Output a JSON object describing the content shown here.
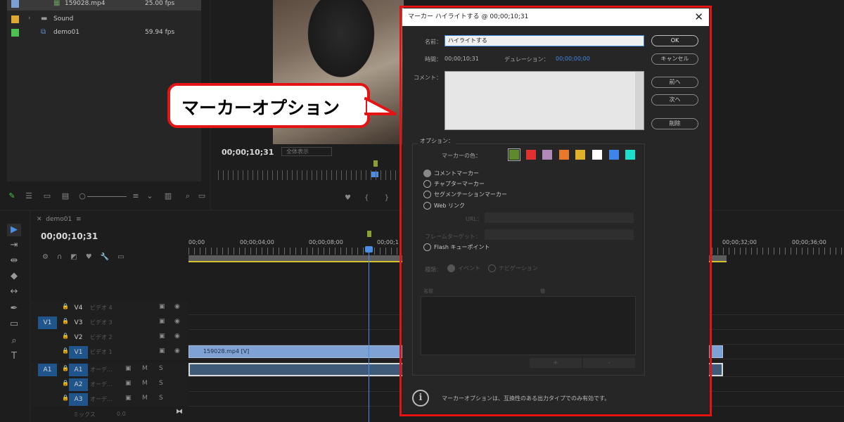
{
  "project": {
    "rows": [
      {
        "name": "159028.mp4",
        "fps": "25.00 fps",
        "color": "#7aa0d4"
      },
      {
        "name": "Sound",
        "fps": "",
        "color": "#e0a830"
      },
      {
        "name": "demo01",
        "fps": "59.94 fps",
        "color": "#4ec050"
      }
    ]
  },
  "program": {
    "timecode": "00;00;10;31",
    "zoom": "全体表示"
  },
  "timeline": {
    "tab": "demo01",
    "timecode": "00;00;10;31",
    "ruler": [
      "00;00",
      "00;00;04;00",
      "00;00;08;00",
      "00;00;1",
      "00;00;32;00",
      "00;00;36;00"
    ],
    "tracks": [
      {
        "src": "",
        "id": "V4",
        "name": "ビデオ 4"
      },
      {
        "src": "V1",
        "id": "V3",
        "name": "ビデオ 3"
      },
      {
        "src": "",
        "id": "V2",
        "name": "ビデオ 2"
      },
      {
        "src": "",
        "id": "V1",
        "name": "ビデオ 1"
      },
      {
        "src": "A1",
        "id": "A1",
        "name": "オーデ..."
      },
      {
        "src": "",
        "id": "A2",
        "name": "オーデ..."
      },
      {
        "src": "",
        "id": "A3",
        "name": "オーデ..."
      }
    ],
    "clip_label": "159028.mp4 [V]",
    "mix_label": "ミックス",
    "mix_value": "0.0",
    "m_label": "M",
    "s_label": "S"
  },
  "callout": {
    "text": "マーカーオプション"
  },
  "dialog": {
    "title": "マーカー ハイライトする @ 00;00;10;31",
    "name_label": "名前：",
    "name_value": "ハイライトする",
    "time_label": "時間：",
    "time_value": "00;00;10;31",
    "duration_label": "デュレーション：",
    "duration_value": "00;00;00;00",
    "comment_label": "コメント：",
    "buttons": {
      "ok": "OK",
      "cancel": "キャンセル",
      "prev": "前へ",
      "next": "次へ",
      "delete": "削除"
    },
    "options_title": "オプション：",
    "color_label": "マーカーの色：",
    "colors": [
      "#5e8a2e",
      "#e03030",
      "#b08ab8",
      "#e8782a",
      "#e0b02c",
      "#ffffff",
      "#3f84e8",
      "#1de0cc"
    ],
    "selected_color": 0,
    "radios": {
      "comment": "コメントマーカー",
      "chapter": "チャプターマーカー",
      "segment": "セグメンテーションマーカー",
      "web": "Web リンク",
      "flash": "Flash キューポイント"
    },
    "url_label": "URL：",
    "frame_target_label": "フレームターゲット：",
    "type_label": "種類：",
    "event_label": "イベント",
    "navigation_label": "ナビゲーション",
    "col_name": "名前",
    "col_value": "値",
    "add": "+",
    "remove": "-",
    "info": "マーカーオプションは、互換性のある出力タイプでのみ有効です。"
  }
}
